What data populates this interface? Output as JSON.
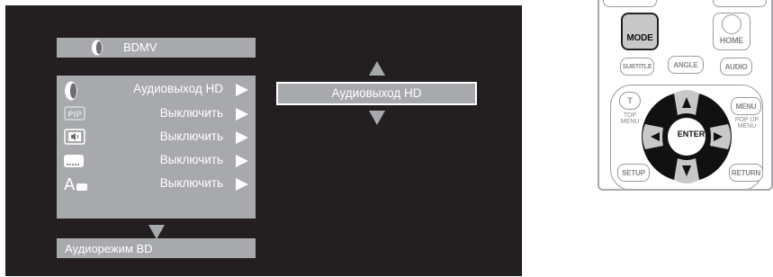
{
  "osd": {
    "title": "BDMV",
    "rows": [
      {
        "icon": "speaker-icon",
        "value": "Аудиовыход HD"
      },
      {
        "icon": "pip-icon",
        "icon_text": "PIP",
        "value": "Выключить"
      },
      {
        "icon": "secondary-audio-icon",
        "value": "Выключить"
      },
      {
        "icon": "subtitle-icon",
        "value": "Выключить"
      },
      {
        "icon": "subtitle-style-icon",
        "icon_text": "A",
        "value": "Выключить"
      }
    ],
    "bottom_label": "Аудиорежим BD",
    "selection": "Аудиовыход HD"
  },
  "remote": {
    "mode": "MODE",
    "home": "HOME",
    "subtitle": "SUBTITLE",
    "angle": "ANGLE",
    "audio": "AUDIO",
    "t": "T",
    "top_menu": "TOP MENU",
    "menu": "MENU",
    "popup_menu": "POP UP MENU",
    "enter": "ENTER",
    "setup": "SETUP",
    "return": "RETURN"
  },
  "colors": {
    "screen_bg": "#231f20",
    "panel_gray": "#a7a9ac",
    "text_white": "#ffffff",
    "dpad_black": "#111111"
  }
}
